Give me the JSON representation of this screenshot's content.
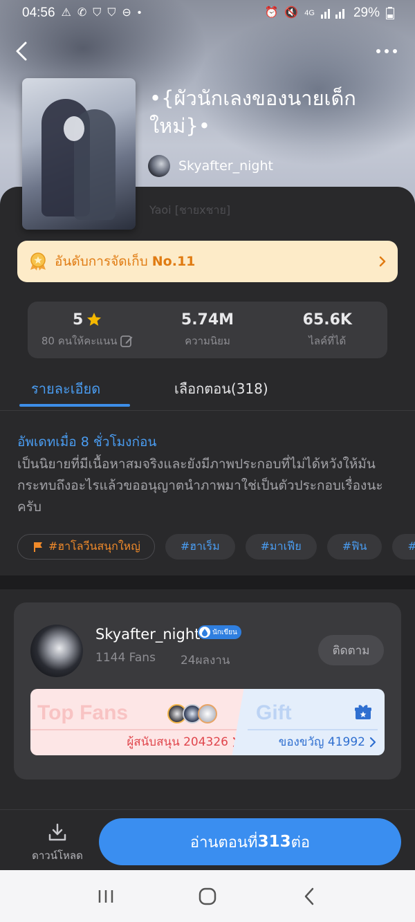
{
  "status_bar": {
    "time": "04:56",
    "signal": "4G",
    "battery": "29%"
  },
  "book": {
    "title": "•{ผัวนักเลงของนายเด็กใหม่}•",
    "author": "Skyafter_night",
    "genre": "Yaoi [ชายxชาย]"
  },
  "ranking": {
    "label": "อันดับการจัดเก็บ",
    "rank": "No.11"
  },
  "stats": {
    "rating": "5",
    "rating_label": "80 คนให้คะแนน",
    "popularity": "5.74M",
    "popularity_label": "ความนิยม",
    "likes": "65.6K",
    "likes_label": "ไลค์ที่ได้"
  },
  "tabs": {
    "details": "รายละเอียด",
    "episodes": "เลือกตอน(318)"
  },
  "details": {
    "updated": "อัพเดทเมื่อ 8 ชั่วโมงก่อน",
    "description": "เป็นนิยายที่มีเนื้อหาสมจริงและยังมีภาพประกอบที่ไม่ได้หวังให้มันกระทบถึงอะไรแล้วขออนุญาตนำภาพมาใช่เป็นตัวประกอบเรื่องนะครับ"
  },
  "tags": [
    "#ฮาโลวีนสนุกใหญ่",
    "#ฮาเร็ม",
    "#มาเฟีย",
    "#ฟิน",
    "#นักเล"
  ],
  "author_card": {
    "name": "Skyafter_night",
    "badge": "นักเขียน",
    "fans": "1144 Fans",
    "works": "24ผลงาน",
    "follow": "ติดตาม",
    "top_fans_title": "Top Fans",
    "supporters": "ผู้สนับสนุน 204326",
    "gift_title": "Gift",
    "gifts": "ของขวัญ 41992"
  },
  "bottom_bar": {
    "download": "ดาวน์โหลด",
    "read_prefix": "อ่านตอนที่",
    "read_number": "313",
    "read_suffix": "ต่อ"
  },
  "icons": {
    "back": "chevron-left-icon",
    "more": "more-dots-icon",
    "medal": "medal-icon",
    "star": "star-icon",
    "edit": "edit-icon",
    "flag": "flag-icon",
    "gift": "gift-icon",
    "download": "download-icon"
  },
  "colors": {
    "accent_blue": "#3a8ef0",
    "rank_orange": "#e07b12",
    "fans_red": "#e0464c",
    "star_yellow": "#f5b800"
  }
}
